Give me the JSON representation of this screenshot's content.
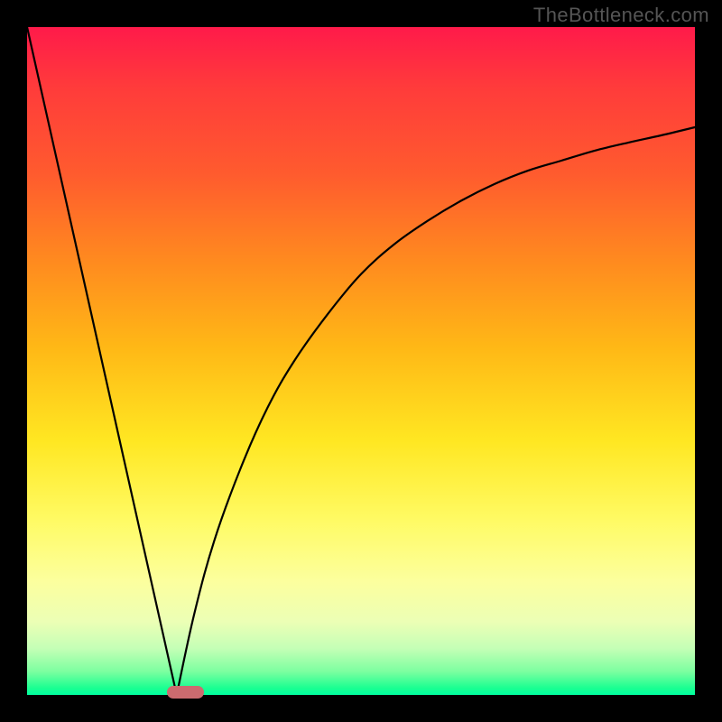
{
  "watermark": "TheBottleneck.com",
  "colors": {
    "page_bg": "#000000",
    "curve": "#000000",
    "marker": "#cc6b6f",
    "gradient_top": "#ff1a4a",
    "gradient_bottom": "#00ffa0"
  },
  "chart_data": {
    "type": "line",
    "title": "",
    "xlabel": "",
    "ylabel": "",
    "xlim": [
      0,
      100
    ],
    "ylim": [
      0,
      100
    ],
    "grid": false,
    "legend": false,
    "description": "V-shaped bottleneck curve. Left branch is a straight line from (0,100) down to the minimum near x≈22. Right branch rises with decreasing slope (saturating curve) from the minimum toward ~(100,85). Optimal region marked by a rounded pill at y≈0 around x≈21–26.5.",
    "series": [
      {
        "name": "left_branch",
        "x": [
          0,
          22.4
        ],
        "y": [
          100,
          0
        ]
      },
      {
        "name": "right_branch",
        "x": [
          22.4,
          25,
          28,
          32,
          36,
          40,
          45,
          50,
          55,
          60,
          65,
          70,
          75,
          80,
          85,
          90,
          95,
          100
        ],
        "y": [
          0,
          12,
          23,
          34,
          43,
          50,
          57,
          63,
          67.5,
          71,
          74,
          76.5,
          78.5,
          80,
          81.5,
          82.7,
          83.8,
          85
        ]
      }
    ],
    "marker": {
      "x_start": 21,
      "x_end": 26.5,
      "y": 0
    }
  }
}
